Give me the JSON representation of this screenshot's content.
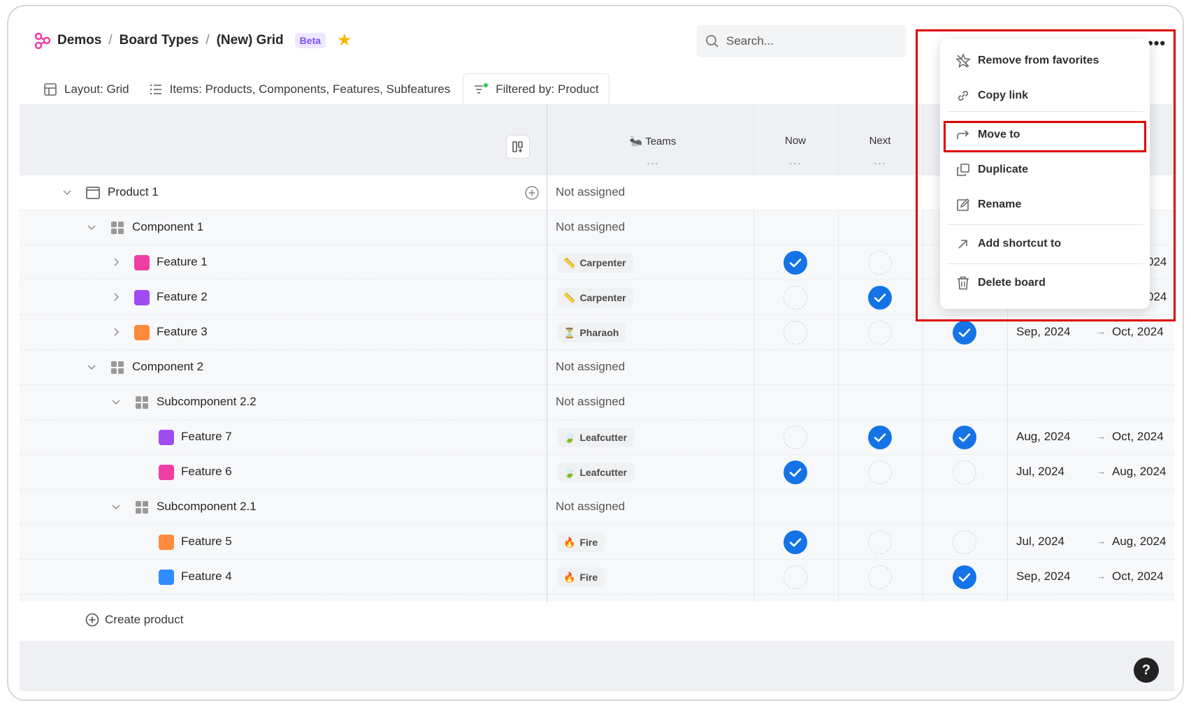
{
  "breadcrumb": {
    "items": [
      "Demos",
      "Board Types",
      "(New) Grid"
    ],
    "separator": "/",
    "badge": "Beta"
  },
  "search": {
    "placeholder": "Search..."
  },
  "toolbar": {
    "layout": "Layout: Grid",
    "items": "Items: Products, Components, Features, Subfeatures",
    "filter": "Filtered by: Product"
  },
  "columns": {
    "teams": "Teams",
    "now": "Now",
    "next": "Next",
    "dots": "···"
  },
  "colors": {
    "accent": "#1473e6",
    "pink": "#ef3ea2",
    "purple": "#a14cf2",
    "orange": "#ff8a3d",
    "blue": "#2f8cff",
    "highlight": "#e00000"
  },
  "rows": [
    {
      "label": "Product 1",
      "type": "product",
      "teams": "Not assigned"
    },
    {
      "label": "Component 1",
      "type": "component",
      "teams": "Not assigned"
    },
    {
      "label": "Feature 1",
      "type": "feature",
      "team": "Carpenter",
      "now": true,
      "next": false,
      "later": null,
      "start": "",
      "end": "024"
    },
    {
      "label": "Feature 2",
      "type": "feature",
      "team": "Carpenter",
      "now": false,
      "next": true,
      "later": null,
      "start": "",
      "end": "024"
    },
    {
      "label": "Feature 3",
      "type": "feature",
      "team": "Pharaoh",
      "now": false,
      "next": false,
      "later": true,
      "start": "Sep, 2024",
      "end": "Oct, 2024"
    },
    {
      "label": "Component 2",
      "type": "component",
      "teams": "Not assigned"
    },
    {
      "label": "Subcomponent 2.2",
      "type": "component",
      "teams": "Not assigned"
    },
    {
      "label": "Feature 7",
      "type": "feature",
      "team": "Leafcutter",
      "now": false,
      "next": true,
      "later": true,
      "start": "Aug, 2024",
      "end": "Oct, 2024"
    },
    {
      "label": "Feature 6",
      "type": "feature",
      "team": "Leafcutter",
      "now": true,
      "next": false,
      "later": false,
      "start": "Jul, 2024",
      "end": "Aug, 2024"
    },
    {
      "label": "Subcomponent 2.1",
      "type": "component",
      "teams": "Not assigned"
    },
    {
      "label": "Feature 5",
      "type": "feature",
      "team": "Fire",
      "now": true,
      "next": false,
      "later": false,
      "start": "Jul, 2024",
      "end": "Aug, 2024"
    },
    {
      "label": "Feature 4",
      "type": "feature",
      "team": "Fire",
      "now": false,
      "next": false,
      "later": true,
      "start": "Sep, 2024",
      "end": "Oct, 2024"
    }
  ],
  "create_product": "Create product",
  "help": "?",
  "menu": {
    "items": [
      "Remove from favorites",
      "Copy link",
      "Move to",
      "Duplicate",
      "Rename",
      "Add shortcut to",
      "Delete board"
    ]
  }
}
